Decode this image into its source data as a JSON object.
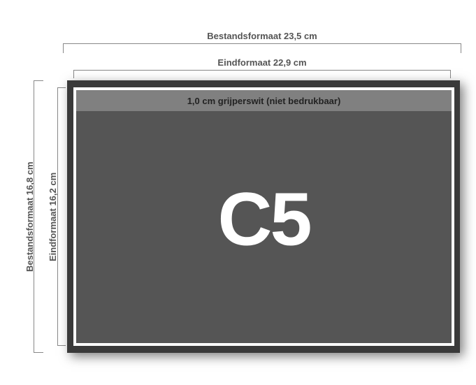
{
  "dimensions": {
    "bestand_width_label": "Bestandsformaat 23,5 cm",
    "eind_width_label": "Eindformaat 22,9 cm",
    "bestand_height_label": "Bestandsformaat 16,8 cm",
    "eind_height_label": "Eindformaat 16,2 cm"
  },
  "envelope": {
    "gripper_text": "1,0 cm grijperswit (niet bedrukbaar)",
    "format_code": "C5"
  }
}
